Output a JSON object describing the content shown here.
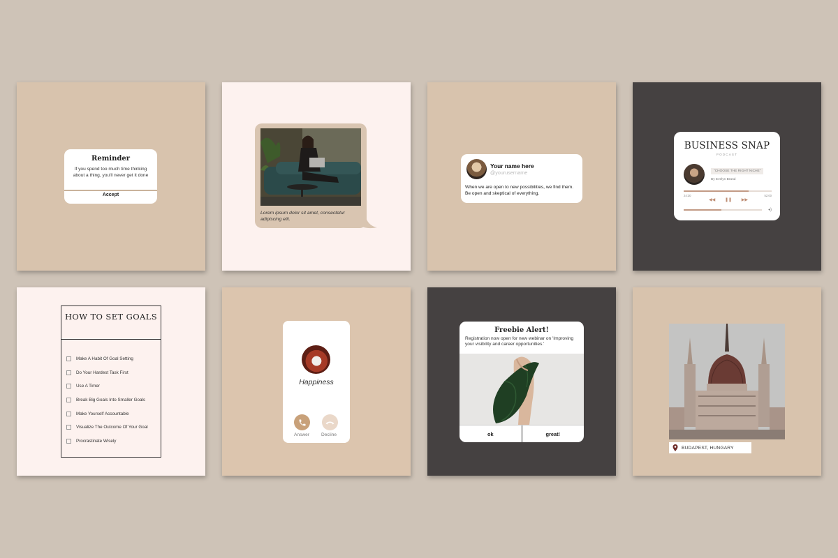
{
  "reminder": {
    "title": "Reminder",
    "message": "If you spend too much time thinking about a thing, you'll never get it done",
    "button": "Accept"
  },
  "bubble": {
    "caption": "Lorem ipsum dolor sit amet, consectetur adipiscing elit."
  },
  "tweet": {
    "name": "Your name here",
    "username": "@yourusername",
    "body": "When we are open to new possibilities, we find them. Be open and skeptical of everything."
  },
  "podcast": {
    "title": "BUSINESS SNAP",
    "subtitle": "PODCAST",
    "episode": "\"CHOOSE THE RIGHT NICHE\"",
    "author": "By Evelyn Brand",
    "time_elapsed": "24:30",
    "time_total": "52:00",
    "progress": 0.74,
    "volume": 0.48
  },
  "goals": {
    "title": "HOW TO SET GOALS",
    "items": [
      "Make A Habit Of Goal Setting",
      "Do Your Hardest Task First",
      "Use A Timer",
      "Break Big Goals Into Smaller Goals",
      "Make Yourself Accountable",
      "Visualize The Outcome Of Your Goal",
      "Procrastinate Wisely"
    ]
  },
  "call": {
    "caller": "Happiness",
    "answer": "Answer",
    "decline": "Decline"
  },
  "freebie": {
    "title": "Freebie Alert!",
    "body": "Registration now open for new webinar on 'Improving your visibility and career opportunities.'",
    "button_ok": "ok",
    "button_great": "great!"
  },
  "location": {
    "label": "BUDAPEST, HUNGARY"
  },
  "colors": {
    "background": "#cec3b7",
    "tan": "#d8c3ad",
    "pink": "#fdf2ef",
    "dark": "#454141",
    "accent": "#c29a85"
  },
  "icons": [
    "phone-icon",
    "phone-hangup-icon",
    "location-pin-icon",
    "rewind-icon",
    "pause-icon",
    "fast-forward-icon",
    "volume-icon"
  ]
}
